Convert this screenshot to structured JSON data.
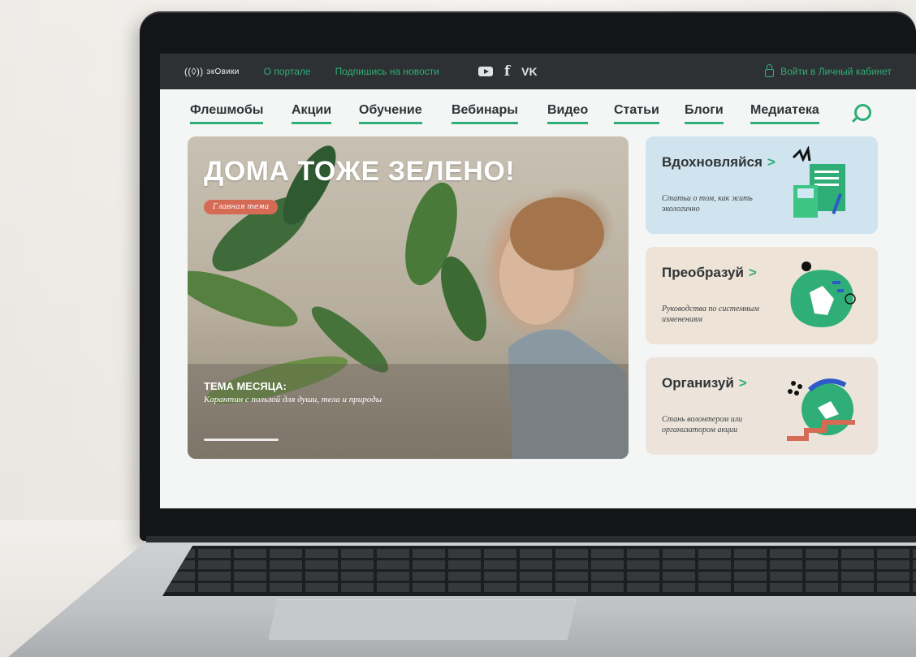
{
  "topbar": {
    "logo_text": "экОвики",
    "links": [
      "О портале",
      "Подпишись на новости"
    ],
    "social_icons": [
      "youtube-icon",
      "facebook-icon",
      "vk-icon"
    ],
    "facebook_glyph": "f",
    "vk_glyph": "VK",
    "login_label": "Войти в Личный кабинет"
  },
  "nav": {
    "items": [
      "Флешмобы",
      "Акции",
      "Обучение",
      "Вебинары",
      "Видео",
      "Статьи",
      "Блоги",
      "Медиатека"
    ]
  },
  "hero": {
    "title": "ДОМА ТОЖЕ ЗЕЛЕНО!",
    "badge": "Главная тема",
    "subtitle": "ТЕМА МЕСЯЦА:",
    "text": "Карантин с пользой для души, тела и природы"
  },
  "cards": [
    {
      "title": "Вдохновляйся",
      "text": "Статьи о том, как жить экологично",
      "bg": "#cfe4ef"
    },
    {
      "title": "Преобразуй",
      "text": "Руководства по системным изменениям",
      "bg": "#ede3d6"
    },
    {
      "title": "Организуй",
      "text": "Стань волонтером или организатором акции",
      "bg": "#ece4db"
    }
  ],
  "colors": {
    "accent": "#2fae77",
    "topbar": "#2d3133",
    "badge": "#d56b55"
  }
}
